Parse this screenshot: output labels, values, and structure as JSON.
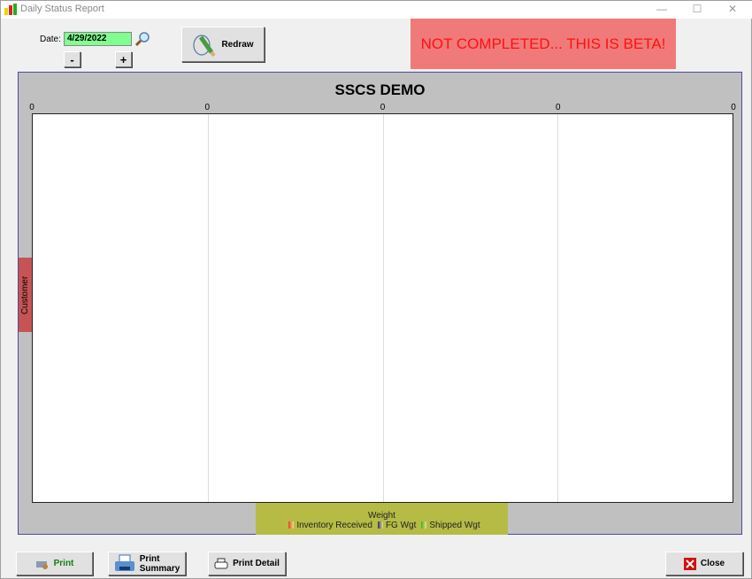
{
  "window": {
    "title": "Daily Status Report",
    "minimize": "—",
    "maximize": "☐",
    "close": "✕"
  },
  "toolbar": {
    "date_label": "Date:",
    "date_value": "4/29/2022",
    "minus_label": "-",
    "plus_label": "+",
    "redraw_label": "Redraw"
  },
  "banner": {
    "text": "NOT COMPLETED... THIS IS BETA!",
    "color": "#f07a7a"
  },
  "chart_data": {
    "type": "bar",
    "orientation": "horizontal",
    "title": "SSCS DEMO",
    "xlabel": "Weight",
    "ylabel": "Customer",
    "x_ticks": [
      "0",
      "0",
      "0",
      "0",
      "0"
    ],
    "categories": [],
    "grid": true,
    "legend_placement": "bottom",
    "series": [
      {
        "name": "Inventory Received",
        "values": [],
        "color": "#e84020"
      },
      {
        "name": "FG Wgt",
        "values": [],
        "color": "#303070"
      },
      {
        "name": "Shipped Wgt",
        "values": [],
        "color": "#40b020"
      }
    ]
  },
  "footer": {
    "print_label": "Print",
    "print_summary_label1": "Print",
    "print_summary_label2": "Summary",
    "print_detail_label": "Print Detail",
    "close_label": "Close"
  }
}
